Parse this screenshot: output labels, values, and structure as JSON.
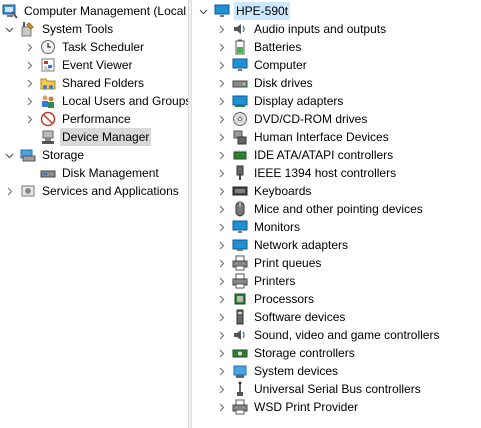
{
  "left_tree": {
    "root": {
      "label": "Computer Management (Local",
      "icon": "computer-management-icon"
    },
    "system_tools": {
      "label": "System Tools",
      "icon": "system-tools-icon",
      "items": [
        {
          "label": "Task Scheduler",
          "icon": "clock-icon"
        },
        {
          "label": "Event Viewer",
          "icon": "event-viewer-icon"
        },
        {
          "label": "Shared Folders",
          "icon": "shared-folder-icon"
        },
        {
          "label": "Local Users and Groups",
          "icon": "users-icon"
        },
        {
          "label": "Performance",
          "icon": "performance-icon"
        },
        {
          "label": "Device Manager",
          "icon": "device-manager-icon"
        }
      ]
    },
    "storage": {
      "label": "Storage",
      "icon": "storage-icon",
      "items": [
        {
          "label": "Disk Management",
          "icon": "disk-management-icon"
        }
      ]
    },
    "services": {
      "label": "Services and Applications",
      "icon": "services-icon"
    }
  },
  "device_tree": {
    "computer_name": "HPE-590t",
    "categories": [
      {
        "label": "Audio inputs and outputs",
        "icon": "speaker-icon"
      },
      {
        "label": "Batteries",
        "icon": "battery-icon"
      },
      {
        "label": "Computer",
        "icon": "monitor-icon"
      },
      {
        "label": "Disk drives",
        "icon": "disk-drive-icon"
      },
      {
        "label": "Display adapters",
        "icon": "display-adapter-icon"
      },
      {
        "label": "DVD/CD-ROM drives",
        "icon": "dvd-icon"
      },
      {
        "label": "Human Interface Devices",
        "icon": "hid-icon"
      },
      {
        "label": "IDE ATA/ATAPI controllers",
        "icon": "ide-controller-icon"
      },
      {
        "label": "IEEE 1394 host controllers",
        "icon": "ieee1394-icon"
      },
      {
        "label": "Keyboards",
        "icon": "keyboard-icon"
      },
      {
        "label": "Mice and other pointing devices",
        "icon": "mouse-icon"
      },
      {
        "label": "Monitors",
        "icon": "monitor-icon"
      },
      {
        "label": "Network adapters",
        "icon": "network-icon"
      },
      {
        "label": "Print queues",
        "icon": "printer-icon"
      },
      {
        "label": "Printers",
        "icon": "printer-icon"
      },
      {
        "label": "Processors",
        "icon": "processor-icon"
      },
      {
        "label": "Software devices",
        "icon": "software-device-icon"
      },
      {
        "label": "Sound, video and game controllers",
        "icon": "speaker-icon"
      },
      {
        "label": "Storage controllers",
        "icon": "storage-controller-icon"
      },
      {
        "label": "System devices",
        "icon": "system-devices-icon"
      },
      {
        "label": "Universal Serial Bus controllers",
        "icon": "usb-icon"
      },
      {
        "label": "WSD Print Provider",
        "icon": "printer-icon"
      }
    ]
  },
  "colors": {
    "selection": "#d9d9d9",
    "header_selection": "#cce8ff",
    "monitor_blue": "#1e90d6"
  }
}
